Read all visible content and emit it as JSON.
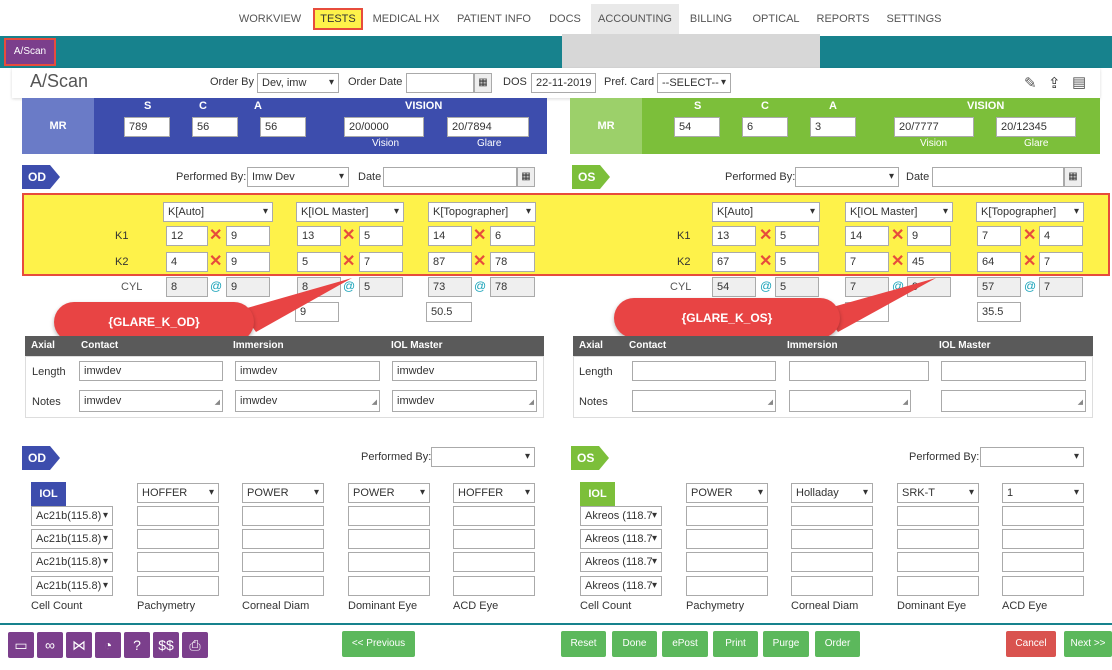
{
  "nav": {
    "tabs": [
      {
        "label": "WORKVIEW",
        "active": false
      },
      {
        "label": "TESTS",
        "active": true
      },
      {
        "label": "MEDICAL HX",
        "active": false
      },
      {
        "label": "PATIENT INFO",
        "active": false
      },
      {
        "label": "DOCS",
        "active": false
      },
      {
        "label": "ACCOUNTING",
        "active": false
      },
      {
        "label": "BILLING",
        "active": false
      },
      {
        "label": "OPTICAL",
        "active": false
      },
      {
        "label": "REPORTS",
        "active": false
      },
      {
        "label": "SETTINGS",
        "active": false
      }
    ]
  },
  "subtab": "A/Scan",
  "header": {
    "title": "A/Scan",
    "order_by_label": "Order By",
    "order_by_value": "Dev, imw",
    "order_date_label": "Order Date",
    "order_date_value": "",
    "dos_label": "DOS",
    "dos_value": "22-11-2019",
    "pref_card_label": "Pref. Card",
    "pref_card_value": "--SELECT--"
  },
  "mr": {
    "label": "MR",
    "s": "S",
    "c": "C",
    "a": "A",
    "vision": "VISION",
    "vision_sub": "Vision",
    "glare_sub": "Glare",
    "od": {
      "s": "789",
      "c": "56",
      "a": "56",
      "vision": "20/0000",
      "glare": "20/7894"
    },
    "os": {
      "s": "54",
      "c": "6",
      "a": "3",
      "vision": "20/7777",
      "glare": "20/12345"
    }
  },
  "od": {
    "tag": "OD",
    "performed_by_label": "Performed By:",
    "performed_by": "Imw Dev",
    "date_label": "Date",
    "date": "",
    "k_selects": [
      "K[Auto]",
      "K[IOL Master]",
      "K[Topographer]"
    ],
    "k1_label": "K1",
    "k2_label": "K2",
    "cyl_label": "CYL",
    "k1": [
      [
        "12",
        "9"
      ],
      [
        "13",
        "5"
      ],
      [
        "14",
        "6"
      ]
    ],
    "k2": [
      [
        "4",
        "9"
      ],
      [
        "5",
        "7"
      ],
      [
        "87",
        "78"
      ]
    ],
    "cyl": [
      [
        "8",
        "9"
      ],
      [
        "8",
        "5"
      ],
      [
        "73",
        "78"
      ]
    ],
    "extra": [
      "",
      "9",
      "50.5"
    ]
  },
  "os": {
    "tag": "OS",
    "performed_by_label": "Performed By:",
    "performed_by": "",
    "date_label": "Date",
    "date": "",
    "k_selects": [
      "K[Auto]",
      "K[IOL Master]",
      "K[Topographer]"
    ],
    "k1_label": "K1",
    "k2_label": "K2",
    "cyl_label": "CYL",
    "k1": [
      [
        "13",
        "5"
      ],
      [
        "14",
        "9"
      ],
      [
        "7",
        "4"
      ]
    ],
    "k2": [
      [
        "67",
        "5"
      ],
      [
        "7",
        "45"
      ],
      [
        "64",
        "7"
      ]
    ],
    "cyl": [
      [
        "54",
        "5"
      ],
      [
        "7",
        "9"
      ],
      [
        "57",
        "7"
      ]
    ],
    "extra": [
      "",
      "5.5",
      "35.5"
    ]
  },
  "callouts": {
    "od": "{GLARE_K_OD}",
    "os": "{GLARE_K_OS}"
  },
  "axial": {
    "headers": [
      "Axial",
      "Contact",
      "Immersion",
      "IOL Master"
    ],
    "length_label": "Length",
    "notes_label": "Notes",
    "od": {
      "length": [
        "imwdev",
        "imwdev",
        "imwdev"
      ],
      "notes": [
        "imwdev",
        "imwdev",
        "imwdev"
      ]
    },
    "os": {
      "length": [
        "",
        "",
        ""
      ],
      "notes": [
        "",
        "",
        ""
      ]
    }
  },
  "iol": {
    "performed_by_label": "Performed By:",
    "label": "IOL",
    "od": {
      "tag": "OD",
      "formulas": [
        "HOFFER",
        "POWER",
        "POWER",
        "HOFFER"
      ],
      "lenses": [
        "Ac21b(115.8)",
        "Ac21b(115.8)",
        "Ac21b(115.8)",
        "Ac21b(115.8)"
      ]
    },
    "os": {
      "tag": "OS",
      "formulas": [
        "POWER",
        "Holladay",
        "SRK-T",
        "1"
      ],
      "lenses": [
        "Akreos (118.7",
        "Akreos (118.7",
        "Akreos (118.7",
        "Akreos (118.7"
      ]
    },
    "bottom_labels": [
      "Cell Count",
      "Pachymetry",
      "Corneal Diam",
      "Dominant Eye",
      "ACD Eye"
    ]
  },
  "footer": {
    "previous": "<< Previous",
    "reset": "Reset",
    "done": "Done",
    "epost": "ePost",
    "print": "Print",
    "purge": "Purge",
    "order": "Order",
    "cancel": "Cancel",
    "next": "Next >>"
  },
  "footer_icons": [
    "monitor-icon",
    "glasses-icon",
    "share-icon",
    "gauge-icon",
    "help-icon",
    "dollar-icon",
    "printer-icon"
  ],
  "colors": {
    "teal": "#17828d",
    "purple": "#7b3f8c",
    "od_blue": "#3d4dad",
    "os_green": "#7cbf3a",
    "highlight": "#fef24a",
    "red": "#e74c3c"
  }
}
